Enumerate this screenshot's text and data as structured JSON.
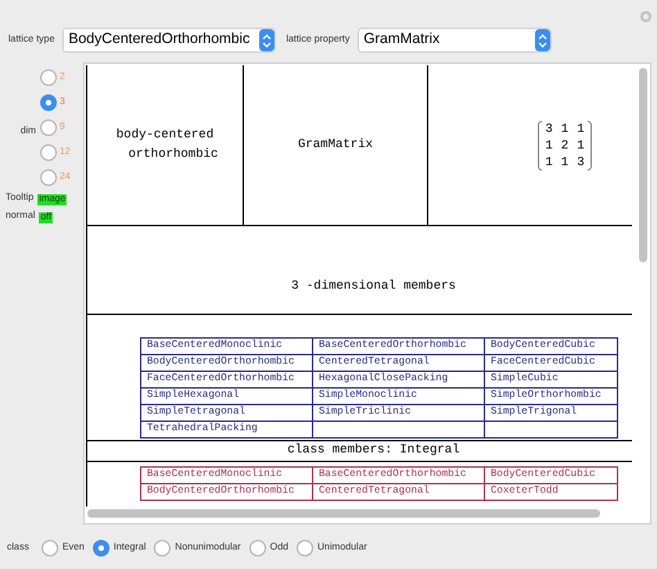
{
  "lattice_type": {
    "label": "lattice type",
    "value": "BodyCenteredOrthorhombic"
  },
  "lattice_property": {
    "label": "lattice property",
    "value": "GramMatrix"
  },
  "dim": {
    "label": "dim",
    "options": [
      {
        "label": "2",
        "selected": false
      },
      {
        "label": "3",
        "selected": true
      },
      {
        "label": "9",
        "selected": false
      },
      {
        "label": "12",
        "selected": false
      },
      {
        "label": "24",
        "selected": false
      }
    ]
  },
  "flags": [
    {
      "label": "Tooltip",
      "value": "image"
    },
    {
      "label": "normal",
      "value": "off"
    }
  ],
  "output": {
    "name_lines": [
      "body-centered",
      "orthorhombic"
    ],
    "property": "GramMatrix",
    "matrix": [
      [
        "3",
        "1",
        "1"
      ],
      [
        "1",
        "2",
        "1"
      ],
      [
        "1",
        "1",
        "3"
      ]
    ],
    "members_heading": {
      "number": "3",
      "text": "-dimensional members"
    },
    "dimensional_members": [
      [
        "BaseCenteredMonoclinic",
        "BaseCenteredOrthorhombic",
        "BodyCenteredCubic"
      ],
      [
        "BodyCenteredOrthorhombic",
        "CenteredTetragonal",
        "FaceCenteredCubic"
      ],
      [
        "FaceCenteredOrthorhombic",
        "HexagonalClosePacking",
        "SimpleCubic"
      ],
      [
        "SimpleHexagonal",
        "SimpleMonoclinic",
        "SimpleOrthorhombic"
      ],
      [
        "SimpleTetragonal",
        "SimpleTriclinic",
        "SimpleTrigonal"
      ],
      [
        "TetrahedralPacking"
      ]
    ],
    "class_heading": {
      "label": "class members:",
      "value": "Integral"
    },
    "class_members": [
      [
        "BaseCenteredMonoclinic",
        "BaseCenteredOrthorhombic",
        "BodyCenteredCubic"
      ],
      [
        "BodyCenteredOrthorhombic",
        "CenteredTetragonal",
        "CoxeterTodd"
      ]
    ]
  },
  "class": {
    "label": "class",
    "options": [
      {
        "label": "Even",
        "selected": false
      },
      {
        "label": "Integral",
        "selected": true
      },
      {
        "label": "Nonunimodular",
        "selected": false
      },
      {
        "label": "Odd",
        "selected": false
      },
      {
        "label": "Unimodular",
        "selected": false
      }
    ]
  }
}
